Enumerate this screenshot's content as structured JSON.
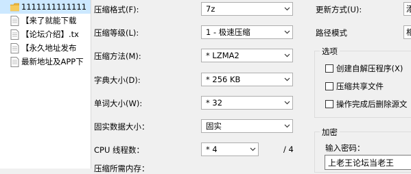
{
  "files": [
    {
      "name": "1111111111111",
      "type": "folder",
      "selected": true
    },
    {
      "name": "【来了就能下载",
      "type": "file"
    },
    {
      "name": "【论坛介绍】.tx",
      "type": "file"
    },
    {
      "name": "【永久地址发布",
      "type": "file"
    },
    {
      "name": "最新地址及APP下",
      "type": "file"
    }
  ],
  "compression": {
    "format_label": "压缩格式(F):",
    "format_value": "7z",
    "level_label": "压缩等级(L):",
    "level_value": "1 - 极速压缩",
    "method_label": "压缩方法(M):",
    "method_value": "* LZMA2",
    "dict_label": "字典大小(D):",
    "dict_value": "* 256 KB",
    "word_label": "单词大小(W):",
    "word_value": "* 32",
    "solid_label": "固实数据大小：",
    "solid_value": "固实",
    "cpu_label": "CPU 线程数：",
    "cpu_value": "* 4",
    "cpu_total": "/ 4",
    "memory_label": "压缩所需内存："
  },
  "right": {
    "update_label": "更新方式(U):",
    "update_value": "添",
    "path_label": "路径模式",
    "path_value": "相",
    "options_title": "选项",
    "options": [
      {
        "label": "创建自解压程序(X)",
        "checked": false
      },
      {
        "label": "压缩共享文件",
        "checked": false
      },
      {
        "label": "操作完成后删除源文",
        "checked": false
      }
    ],
    "encrypt_title": "加密",
    "password_label": "输入密码：",
    "password_value": "上老王论坛当老王"
  },
  "colors": {
    "selection": "#cce8ff",
    "folder": "#e8b33c"
  }
}
